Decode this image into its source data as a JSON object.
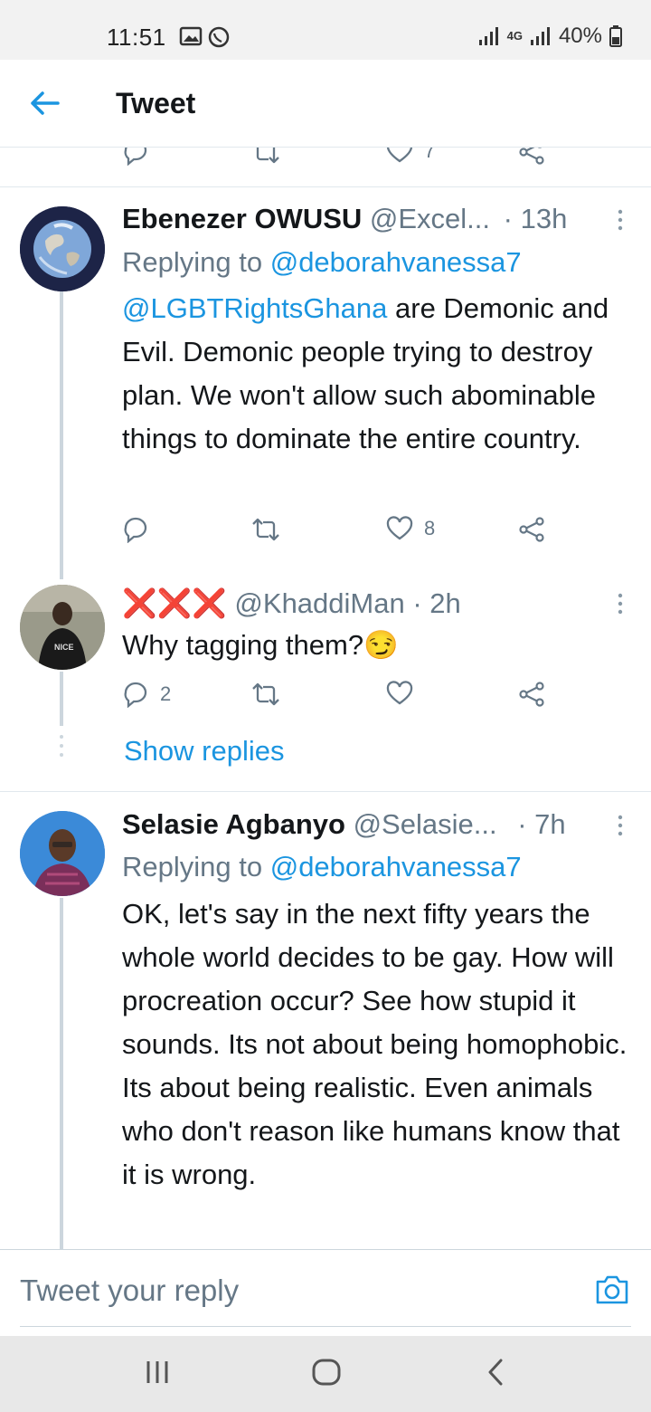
{
  "status_bar": {
    "time": "11:51",
    "network": "4G",
    "battery": "40%"
  },
  "header": {
    "title": "Tweet"
  },
  "previous_actions": {
    "likes": "7"
  },
  "tweets": [
    {
      "name": "Ebenezer OWUSU",
      "handle": "@Excel...",
      "time": "· 13h",
      "replying_prefix": "Replying to",
      "replying_to": "@deborahvanessa7",
      "mention": "@LGBTRightsGhana",
      "text_rest": " are Demonic and Evil. Demonic people trying to destroy plan. We won't allow such abominable things to dominate the entire country.",
      "replies": "",
      "likes": "8"
    },
    {
      "name": "❌❌❌",
      "handle": "@KhaddiMan",
      "time": "· 2h",
      "text": "Why tagging them?😏",
      "replies": "2",
      "likes": "",
      "show_replies": "Show replies"
    },
    {
      "name": "Selasie Agbanyo",
      "handle": "@Selasie...",
      "time": "· 7h",
      "replying_prefix": "Replying to",
      "replying_to": "@deborahvanessa7",
      "text": "OK, let's say in the next fifty years the whole world decides to be gay. How will procreation occur? See how stupid it sounds. Its not about being homophobic. Its about being realistic. Even animals who don't reason like humans know that it is wrong."
    }
  ],
  "reply_bar": {
    "placeholder": "Tweet your reply"
  },
  "colors": {
    "accent": "#1b95e0",
    "muted": "#657786",
    "text": "#14171a"
  }
}
